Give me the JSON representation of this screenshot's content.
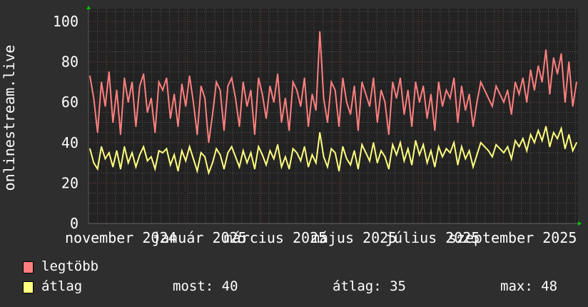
{
  "chart_data": {
    "type": "line",
    "ylabel": "onlinestream.live",
    "ylim": [
      0,
      100
    ],
    "yticks": [
      "0",
      "20",
      "40",
      "60",
      "80",
      "100"
    ],
    "x_range": [
      "2024-10-18",
      "2025-11-02"
    ],
    "xticks": [
      {
        "date": "2024-11-01",
        "label": "november 2024"
      },
      {
        "date": "2025-01-01",
        "label": "január 2025"
      },
      {
        "date": "2025-03-01",
        "label": "március 2025"
      },
      {
        "date": "2025-05-01",
        "label": "május 2025"
      },
      {
        "date": "2025-07-01",
        "label": "július 2025"
      },
      {
        "date": "2025-09-01",
        "label": "szeptember 2025"
      }
    ],
    "grid": true,
    "series": [
      {
        "name": "legtöbb",
        "color": "#ff7f7f",
        "values": [
          73,
          62,
          45,
          70,
          58,
          75,
          50,
          66,
          44,
          72,
          60,
          70,
          48,
          68,
          74,
          55,
          62,
          45,
          70,
          66,
          72,
          52,
          64,
          48,
          69,
          58,
          73,
          60,
          44,
          68,
          62,
          40,
          54,
          70,
          66,
          46,
          68,
          72,
          62,
          48,
          70,
          58,
          66,
          44,
          72,
          64,
          52,
          68,
          60,
          74,
          50,
          62,
          46,
          70,
          66,
          58,
          72,
          48,
          64,
          56,
          95,
          62,
          50,
          70,
          66,
          48,
          72,
          60,
          54,
          68,
          46,
          70,
          64,
          58,
          72,
          50,
          66,
          60,
          44,
          70,
          62,
          72,
          54,
          66,
          48,
          70,
          60,
          68,
          52,
          64,
          46,
          70,
          58,
          66,
          62,
          72,
          50,
          68,
          56,
          64,
          48,
          60,
          70,
          66,
          62,
          58,
          68,
          64,
          60,
          66,
          54,
          70,
          64,
          72,
          60,
          76,
          66,
          78,
          70,
          86,
          64,
          82,
          74,
          84,
          60,
          80,
          58,
          70
        ]
      },
      {
        "name": "átlag",
        "color": "#ffff7f",
        "values": [
          37,
          30,
          27,
          38,
          32,
          35,
          28,
          36,
          27,
          38,
          30,
          35,
          28,
          34,
          38,
          31,
          33,
          27,
          36,
          35,
          37,
          29,
          34,
          26,
          36,
          31,
          38,
          32,
          26,
          35,
          33,
          25,
          30,
          37,
          34,
          27,
          35,
          38,
          33,
          28,
          36,
          30,
          35,
          27,
          38,
          34,
          29,
          36,
          32,
          39,
          28,
          33,
          27,
          37,
          35,
          31,
          38,
          28,
          34,
          30,
          45,
          33,
          28,
          37,
          35,
          26,
          38,
          32,
          29,
          36,
          27,
          39,
          35,
          31,
          40,
          30,
          36,
          33,
          27,
          39,
          34,
          40,
          31,
          37,
          29,
          41,
          34,
          39,
          30,
          36,
          28,
          38,
          33,
          37,
          35,
          40,
          29,
          38,
          32,
          36,
          28,
          34,
          40,
          38,
          36,
          33,
          39,
          37,
          35,
          38,
          32,
          41,
          38,
          42,
          36,
          44,
          40,
          46,
          41,
          48,
          38,
          45,
          42,
          47,
          37,
          44,
          36,
          40
        ]
      }
    ]
  },
  "legend": {
    "items": [
      {
        "label": "legtöbb",
        "color": "#ff7f7f"
      },
      {
        "label": "átlag",
        "color": "#ffff7f"
      }
    ],
    "stats": {
      "now": "most: 40",
      "avg": "átlag: 35",
      "max": "max: 48"
    }
  }
}
